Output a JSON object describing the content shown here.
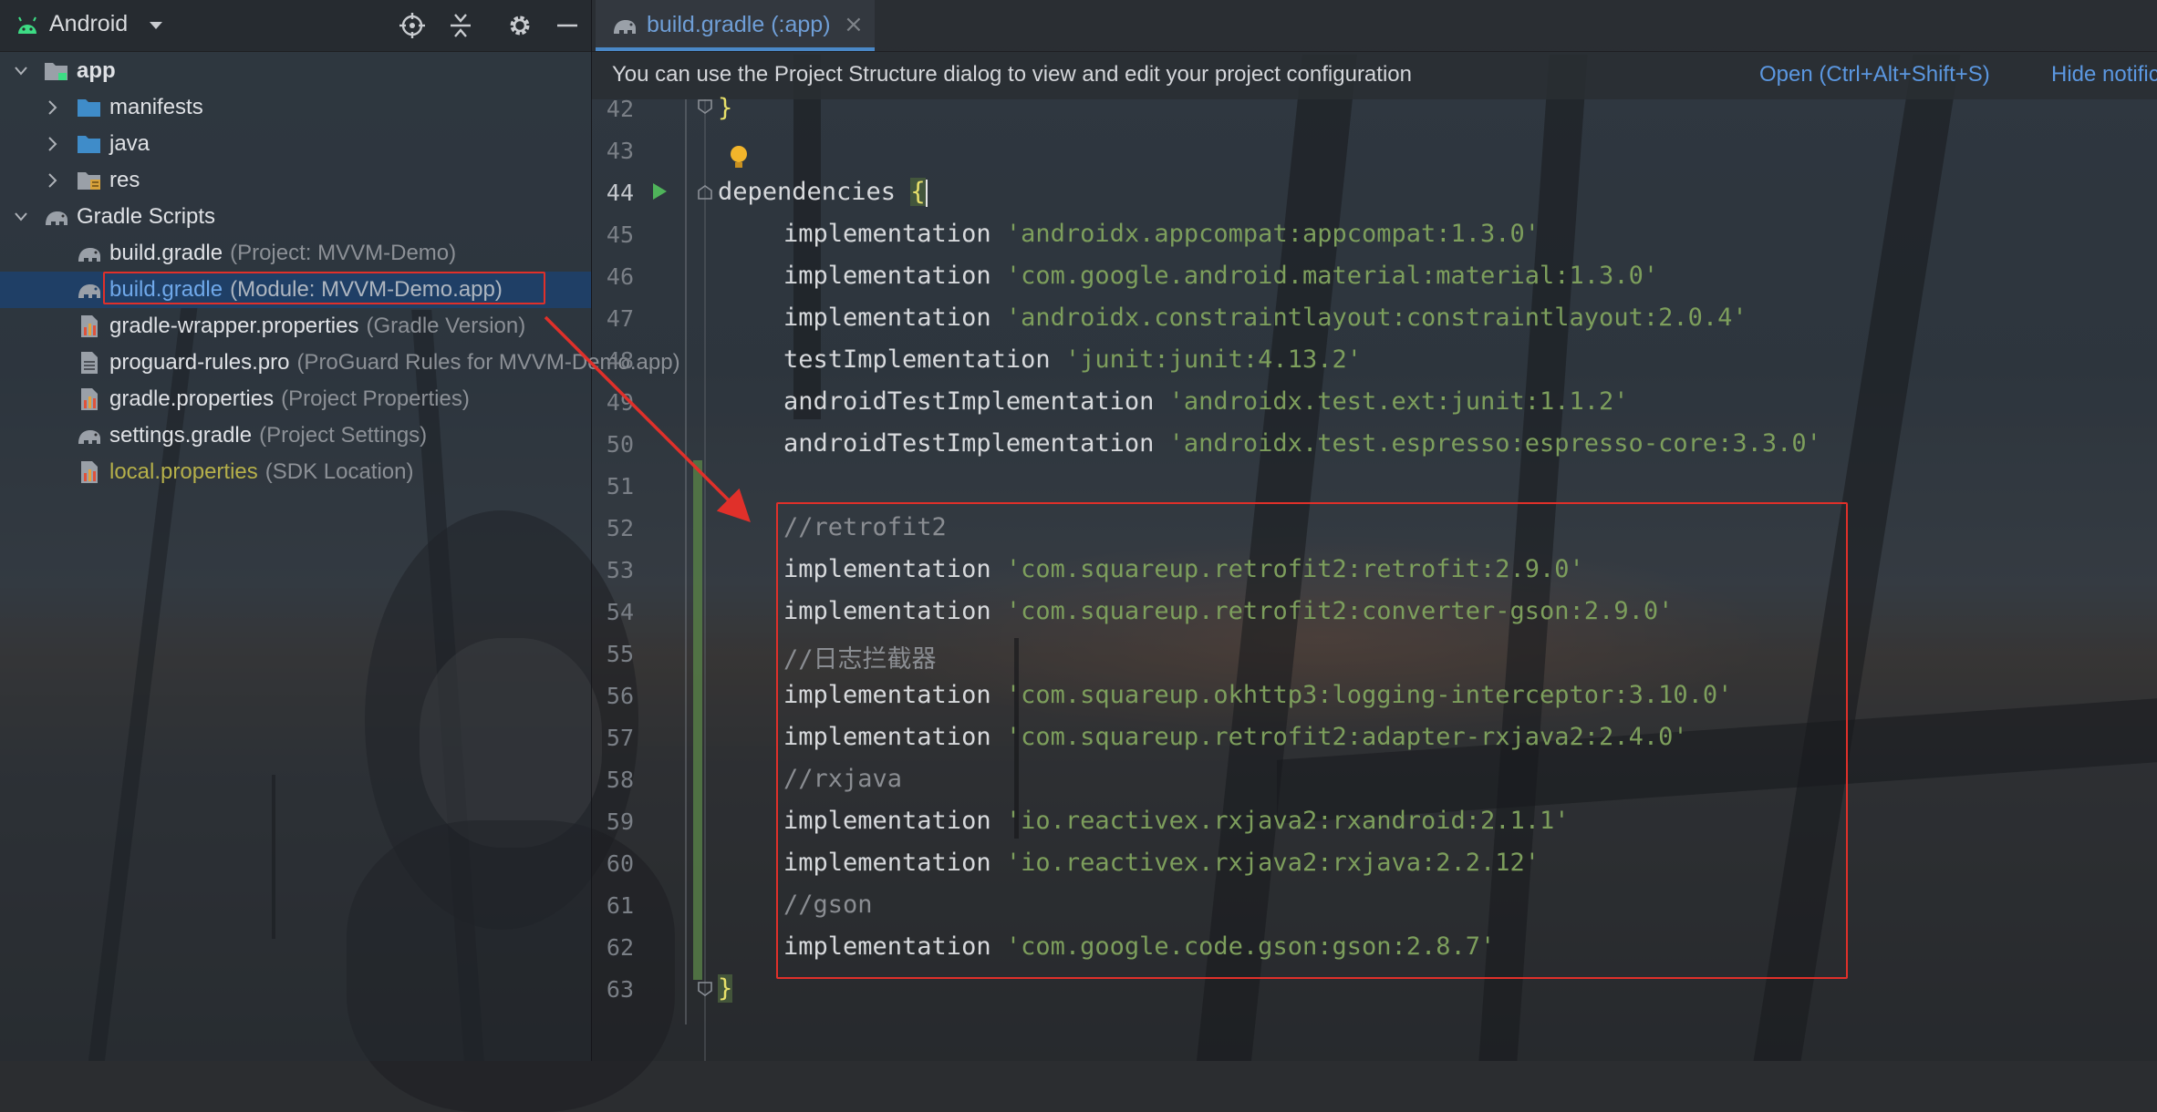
{
  "project_panel": {
    "view_title": "Android",
    "tree": [
      {
        "label": "app",
        "sub": ""
      },
      {
        "label": "manifests",
        "sub": ""
      },
      {
        "label": "java",
        "sub": ""
      },
      {
        "label": "res",
        "sub": ""
      },
      {
        "label": "Gradle Scripts",
        "sub": ""
      },
      {
        "label": "build.gradle",
        "sub": "(Project: MVVM-Demo)"
      },
      {
        "label": "build.gradle",
        "sub": "(Module: MVVM-Demo.app)"
      },
      {
        "label": "gradle-wrapper.properties",
        "sub": "(Gradle Version)"
      },
      {
        "label": "proguard-rules.pro",
        "sub": "(ProGuard Rules for MVVM-Demo.app)"
      },
      {
        "label": "gradle.properties",
        "sub": "(Project Properties)"
      },
      {
        "label": "settings.gradle",
        "sub": "(Project Settings)"
      },
      {
        "label": "local.properties",
        "sub": "(SDK Location)"
      }
    ]
  },
  "editor": {
    "tab_label": "build.gradle (:app)",
    "tab_close": "×",
    "notification": {
      "text": "You can use the Project Structure dialog to view and edit your project configuration",
      "open_link": "Open (Ctrl+Alt+Shift+S)",
      "hide_link": "Hide notification"
    },
    "lines": [
      {
        "num": "42",
        "kw": "",
        "str": "",
        "text": "}"
      },
      {
        "num": "43",
        "kw": "",
        "str": "",
        "text": ""
      },
      {
        "num": "44",
        "kw": "dependencies ",
        "str": "",
        "text": "{"
      },
      {
        "num": "45",
        "kw": "implementation ",
        "str": "'androidx.appcompat:appcompat:1.3.0'",
        "text": ""
      },
      {
        "num": "46",
        "kw": "implementation ",
        "str": "'com.google.android.material:material:1.3.0'",
        "text": ""
      },
      {
        "num": "47",
        "kw": "implementation ",
        "str": "'androidx.constraintlayout:constraintlayout:2.0.4'",
        "text": ""
      },
      {
        "num": "48",
        "kw": "testImplementation ",
        "str": "'junit:junit:4.13.2'",
        "text": ""
      },
      {
        "num": "49",
        "kw": "androidTestImplementation ",
        "str": "'androidx.test.ext:junit:1.1.2'",
        "text": ""
      },
      {
        "num": "50",
        "kw": "androidTestImplementation ",
        "str": "'androidx.test.espresso:espresso-core:3.3.0'",
        "text": ""
      },
      {
        "num": "51",
        "kw": "",
        "str": "",
        "text": ""
      },
      {
        "num": "52",
        "kw": "",
        "str": "",
        "text": "//retrofit2"
      },
      {
        "num": "53",
        "kw": "implementation ",
        "str": "'com.squareup.retrofit2:retrofit:2.9.0'",
        "text": ""
      },
      {
        "num": "54",
        "kw": "implementation ",
        "str": "'com.squareup.retrofit2:converter-gson:2.9.0'",
        "text": ""
      },
      {
        "num": "55",
        "kw": "",
        "str": "",
        "text": "//日志拦截器"
      },
      {
        "num": "56",
        "kw": "implementation ",
        "str": "'com.squareup.okhttp3:logging-interceptor:3.10.0'",
        "text": ""
      },
      {
        "num": "57",
        "kw": "implementation ",
        "str": "'com.squareup.retrofit2:adapter-rxjava2:2.4.0'",
        "text": ""
      },
      {
        "num": "58",
        "kw": "",
        "str": "",
        "text": "//rxjava"
      },
      {
        "num": "59",
        "kw": "implementation ",
        "str": "'io.reactivex.rxjava2:rxandroid:2.1.1'",
        "text": ""
      },
      {
        "num": "60",
        "kw": "implementation ",
        "str": "'io.reactivex.rxjava2:rxjava:2.2.12'",
        "text": ""
      },
      {
        "num": "61",
        "kw": "",
        "str": "",
        "text": "//gson"
      },
      {
        "num": "62",
        "kw": "implementation ",
        "str": "'com.google.code.gson:gson:2.8.7'",
        "text": ""
      },
      {
        "num": "63",
        "kw": "",
        "str": "",
        "text": "}"
      }
    ]
  },
  "colors": {
    "selection": "#1f3f66",
    "annotation_red": "#e0302a",
    "string_green": "#7d9e5c",
    "link_blue": "#5b97e0"
  }
}
